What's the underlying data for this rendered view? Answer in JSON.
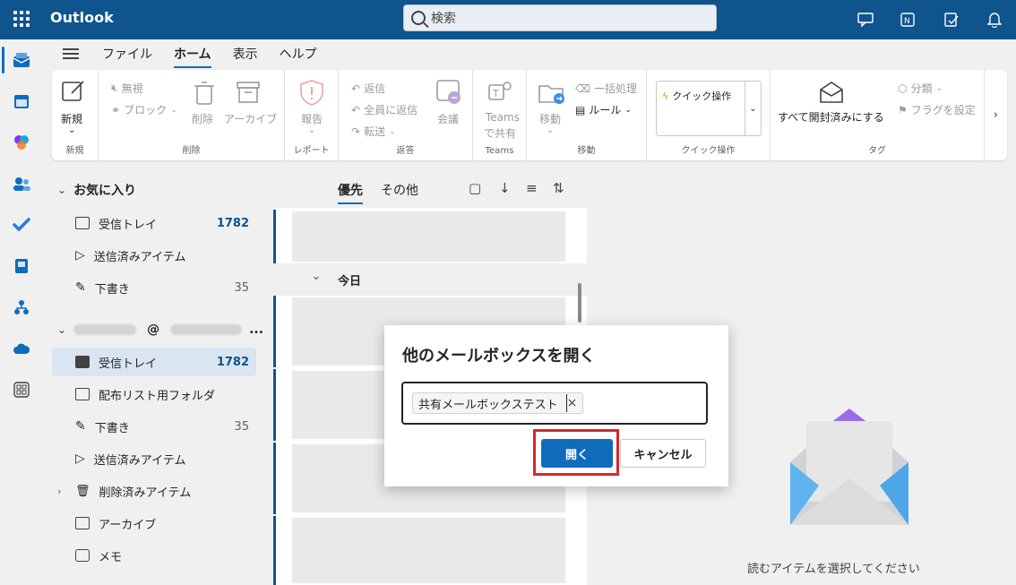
{
  "app": {
    "title": "Outlook",
    "search_placeholder": "検索"
  },
  "tabs": [
    "ファイル",
    "ホーム",
    "表示",
    "ヘルプ"
  ],
  "ribbon": {
    "new_label": "新規",
    "new_group": "新規",
    "ignore": "無視",
    "block": "ブロック",
    "delete": "削除",
    "archive": "アーカイブ",
    "delete_group": "削除",
    "report": "報告",
    "report_group": "レポート",
    "reply": "返信",
    "reply_all": "全員に返信",
    "forward": "転送",
    "meeting": "会議",
    "respond_group": "返答",
    "teams_share_1": "Teams",
    "teams_share_2": "で共有",
    "teams_group": "Teams",
    "move": "移動",
    "bulk": "一括処理",
    "rules": "ルール",
    "move_group": "移動",
    "quick_action": "クイック操作",
    "quick_group": "クイック操作",
    "mark_all_read": "すべて開封済みにする",
    "categorize": "分類",
    "flag": "フラグを設定",
    "tags_group": "タグ"
  },
  "folders": {
    "favorites_header": "お気に入り",
    "favorites": [
      {
        "label": "受信トレイ",
        "count": "1782"
      },
      {
        "label": "送信済みアイテム",
        "count": ""
      },
      {
        "label": "下書き",
        "count": "35"
      }
    ],
    "account_at": "@",
    "account_ellipsis": "...",
    "account_items": [
      {
        "label": "受信トレイ",
        "count": "1782"
      },
      {
        "label": "配布リスト用フォルダ",
        "count": ""
      },
      {
        "label": "下書き",
        "count": "35"
      },
      {
        "label": "送信済みアイテム",
        "count": ""
      },
      {
        "label": "削除済みアイテム",
        "count": ""
      },
      {
        "label": "アーカイブ",
        "count": ""
      },
      {
        "label": "メモ",
        "count": ""
      }
    ]
  },
  "message_list": {
    "tab_focused": "優先",
    "tab_other": "その他",
    "today_header": "今日"
  },
  "reading_pane": {
    "empty_message": "読むアイテムを選択してください"
  },
  "dialog": {
    "title": "他のメールボックスを開く",
    "chip_label": "共有メールボックステスト",
    "chip_remove": "×",
    "open_button": "開く",
    "cancel_button": "キャンセル"
  },
  "colors": {
    "brand": "#0f548c",
    "accent": "#0f6cbd",
    "highlight": "#d7262e"
  }
}
